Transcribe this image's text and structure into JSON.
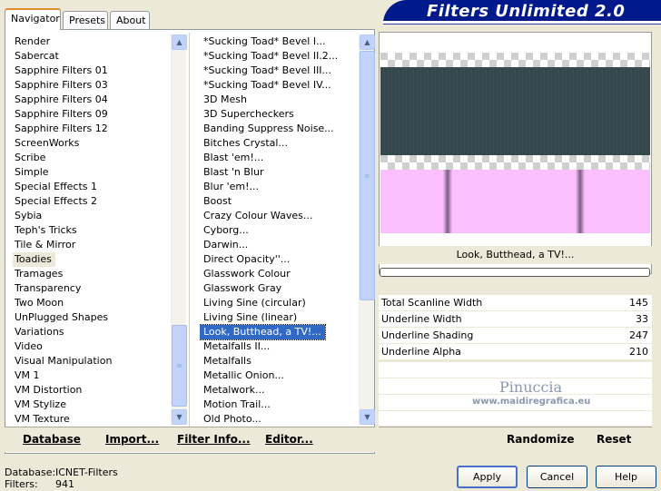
{
  "header": {
    "title": "Filters Unlimited 2.0"
  },
  "tabs": [
    {
      "label": "Navigator"
    },
    {
      "label": "Presets"
    },
    {
      "label": "About"
    }
  ],
  "categories": [
    "Render",
    "Sabercat",
    "Sapphire Filters 01",
    "Sapphire Filters 03",
    "Sapphire Filters 04",
    "Sapphire Filters 09",
    "Sapphire Filters 12",
    "ScreenWorks",
    "Scribe",
    "Simple",
    "Special Effects 1",
    "Special Effects 2",
    "Sybia",
    "Teph's Tricks",
    "Tile & Mirror",
    "Toadies",
    "Tramages",
    "Transparency",
    "Two Moon",
    "UnPlugged Shapes",
    "Variations",
    "Video",
    "Visual Manipulation",
    "VM 1",
    "VM Distortion",
    "VM Stylize",
    "VM Texture"
  ],
  "selected_category": "Toadies",
  "filters": [
    "*Sucking Toad* Bevel I...",
    "*Sucking Toad* Bevel II.2...",
    "*Sucking Toad* Bevel III...",
    "*Sucking Toad* Bevel IV...",
    "3D Mesh",
    "3D Supercheckers",
    "Banding Suppress Noise...",
    "Bitches Crystal...",
    "Blast 'em!...",
    "Blast 'n Blur",
    "Blur 'em!...",
    "Boost",
    "Crazy Colour Waves...",
    "Cyborg...",
    "Darwin...",
    "Direct Opacity''...",
    "Glasswork Colour",
    "Glasswork Gray",
    "Living Sine (circular)",
    "Living Sine (linear)",
    "Look, Butthead, a TV!...",
    "Metalfalls II...",
    "Metalfalls",
    "Metallic Onion...",
    "Metalwork...",
    "Motion Trail...",
    "Old Photo..."
  ],
  "selected_filter": "Look, Butthead, a TV!...",
  "bottom_links": {
    "database": "Database",
    "import": "Import...",
    "filter_info": "Filter Info...",
    "editor": "Editor..."
  },
  "preview": {
    "filter_name": "Look, Butthead, a TV!...",
    "watermark_title": "Pinuccia",
    "watermark_url": "www.maidiregrafica.eu",
    "colors": {
      "dark_band": "#33474d",
      "pink_band": "#fbbefe"
    }
  },
  "params": [
    {
      "name": "Total Scanline Width",
      "value": "145"
    },
    {
      "name": "Underline Width",
      "value": "33"
    },
    {
      "name": "Underline Shading",
      "value": "247"
    },
    {
      "name": "Underline Alpha",
      "value": "210"
    }
  ],
  "right_buttons": {
    "randomize": "Randomize",
    "reset": "Reset"
  },
  "status": {
    "database_label": "Database:",
    "database_value": "ICNET-Filters",
    "filters_label": "Filters:",
    "filters_value": "941"
  },
  "dialog_buttons": {
    "apply": "Apply",
    "cancel": "Cancel",
    "help": "Help"
  }
}
